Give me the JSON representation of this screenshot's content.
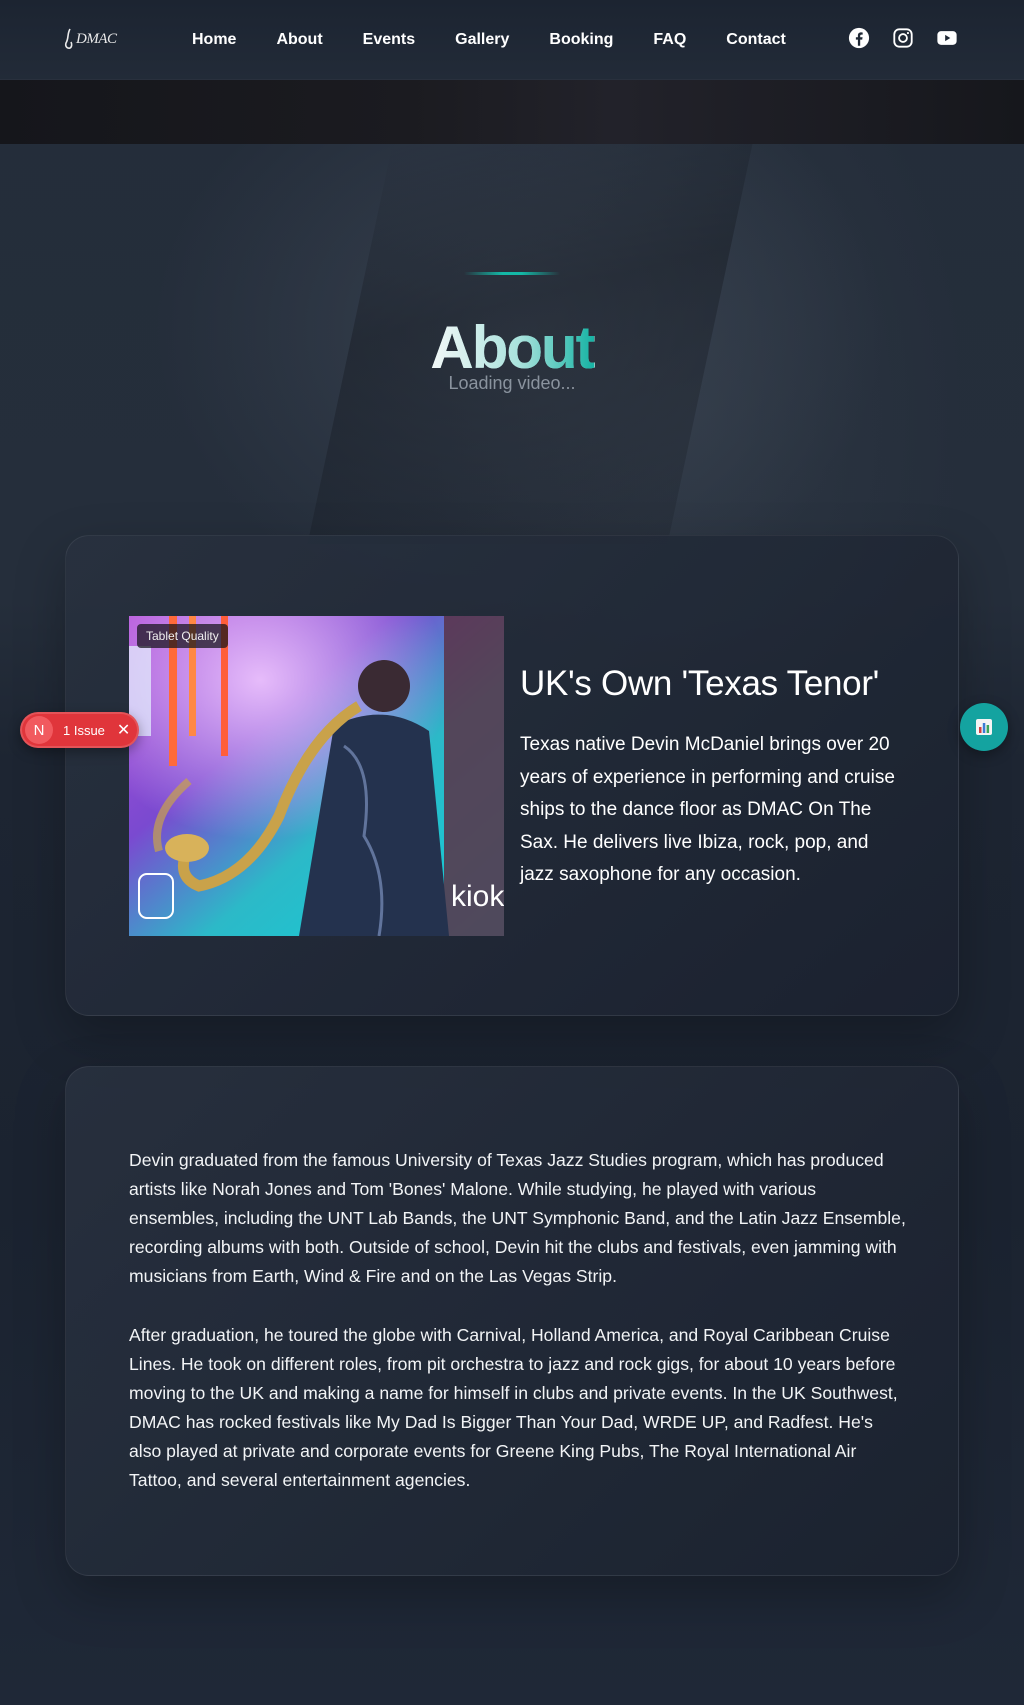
{
  "nav": {
    "logo_text": "DMAC",
    "links": [
      "Home",
      "About",
      "Events",
      "Gallery",
      "Booking",
      "FAQ",
      "Contact"
    ],
    "socials": [
      "facebook-icon",
      "instagram-icon",
      "youtube-icon"
    ]
  },
  "hero": {
    "title": "About",
    "loading_text": "Loading video..."
  },
  "intro_card": {
    "image_badge": "Tablet Quality",
    "image_signage": "kioki",
    "heading": "UK's Own 'Texas Tenor'",
    "text": "Texas native Devin McDaniel brings over 20 years of experience in performing and cruise ships to the dance floor as DMAC On The Sax. He delivers live Ibiza, rock, pop, and jazz saxophone for any occasion."
  },
  "bio_card": {
    "paragraphs": [
      "Devin graduated from the famous University of Texas Jazz Studies program, which has produced artists like Norah Jones and Tom 'Bones' Malone. While studying, he played with various ensembles, including the UNT Lab Bands, the UNT Symphonic Band, and the Latin Jazz Ensemble, recording albums with both. Outside of school, Devin hit the clubs and festivals, even jamming with musicians from Earth, Wind & Fire and on the Las Vegas Strip.",
      "After graduation, he toured the globe with Carnival, Holland America, and Royal Caribbean Cruise Lines. He took on different roles, from pit orchestra to jazz and rock gigs, for about 10 years before moving to the UK and making a name for himself in clubs and private events. In the UK Southwest, DMAC has rocked festivals like My Dad Is Bigger Than Your Dad, WRDE UP, and Radfest. He's also played at private and corporate events for Greene King Pubs, The Royal International Air Tattoo, and several entertainment agencies."
    ]
  },
  "overlays": {
    "issue_badge_letter": "N",
    "issue_label": "1 Issue",
    "issue_close": "✕",
    "fab_icon": "chart-icon"
  },
  "colors": {
    "accent": "#14b8a6",
    "issue_red": "#e0353b",
    "background": "#1a2230"
  }
}
